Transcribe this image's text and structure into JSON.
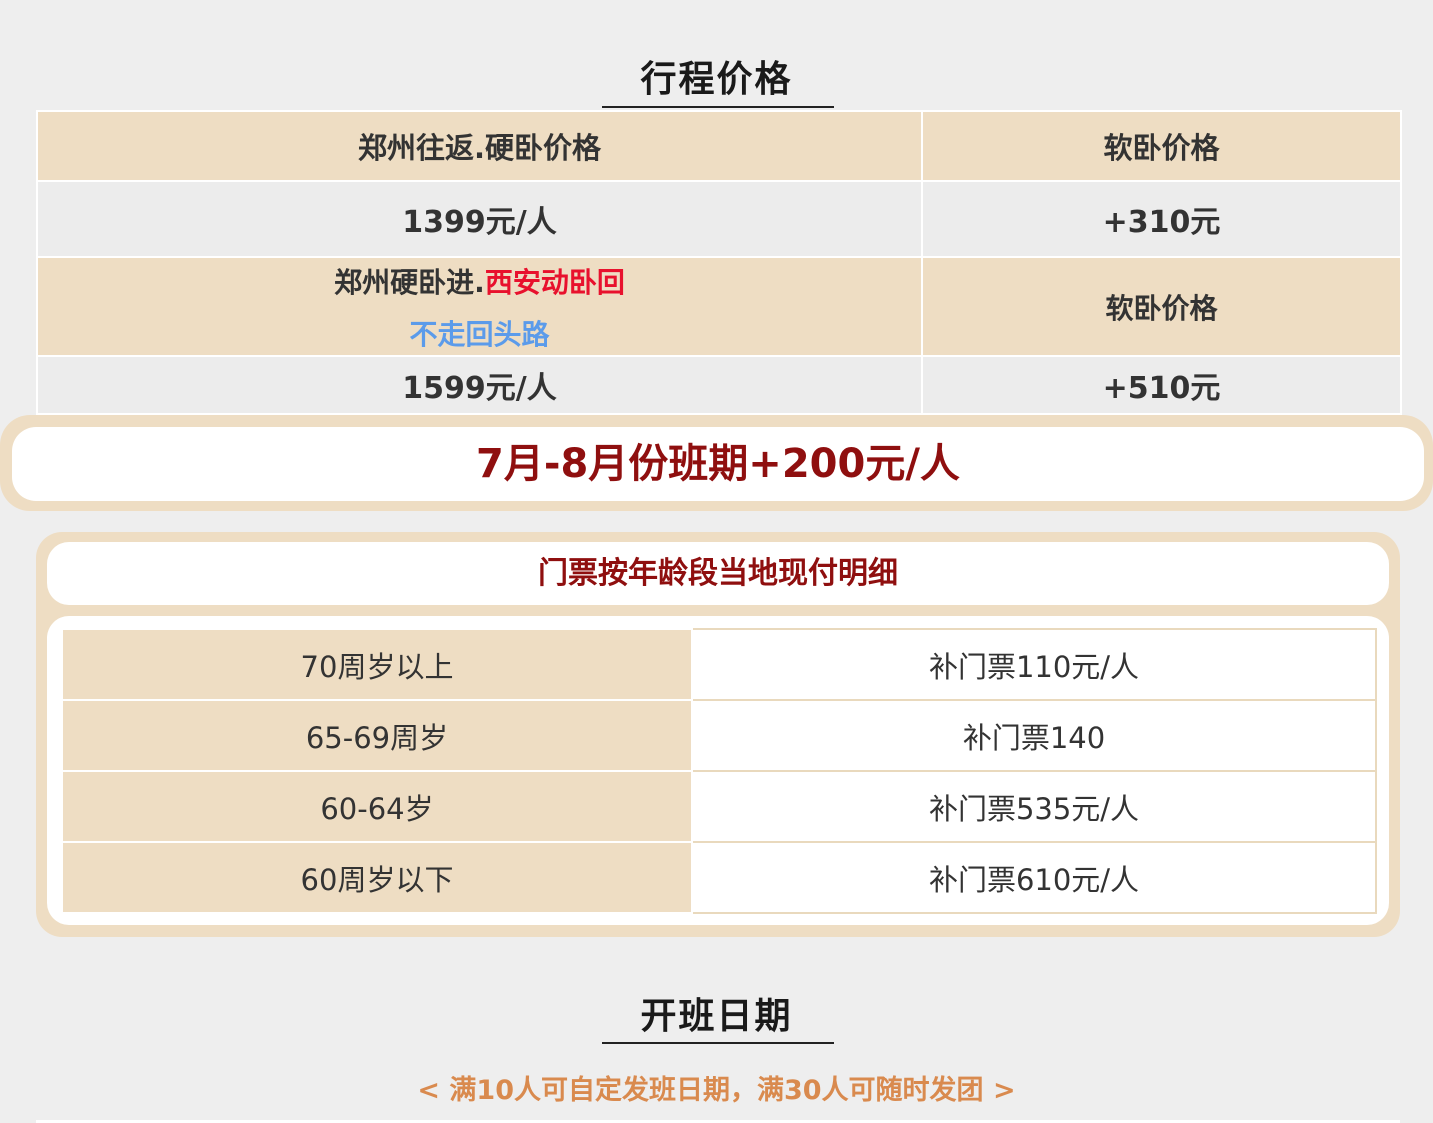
{
  "price_section": {
    "title": "行程价格",
    "header": {
      "col1": "郑州往返.硬卧价格",
      "col2": "软卧价格"
    },
    "row1": {
      "price": "1399元/人",
      "extra": "+310元"
    },
    "row2": {
      "route_part1": "郑州硬卧进.",
      "route_part2": "西安动卧回",
      "note": "不走回头路",
      "col2": "软卧价格"
    },
    "row3": {
      "price": "1599元/人",
      "extra": "+510元"
    }
  },
  "banner": {
    "text": "7月-8月份班期+200元/人"
  },
  "ticket_section": {
    "title": "门票按年龄段当地现付明细",
    "rows": [
      {
        "age": "70周岁以上",
        "price": "补门票110元/人"
      },
      {
        "age": "65-69周岁",
        "price": "补门票140"
      },
      {
        "age": "60-64岁",
        "price": "补门票535元/人"
      },
      {
        "age": "60周岁以下",
        "price": "补门票610元/人"
      }
    ]
  },
  "schedule_section": {
    "title": "开班日期",
    "subtitle": "< 满10人可自定发班日期，满30人可随时发团 >"
  },
  "colors": {
    "background": "#eeeeee",
    "beige": "#eeddc3",
    "dark_red": "#8f0f0f",
    "red": "#e8112d",
    "blue": "#5b9bea",
    "orange": "#d98a4e"
  }
}
